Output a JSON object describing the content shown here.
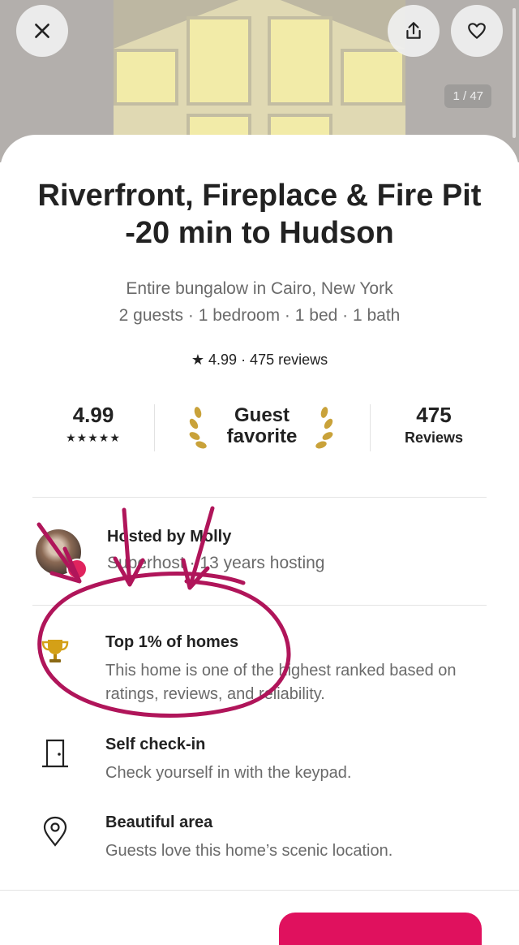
{
  "photo": {
    "counter": "1 / 47"
  },
  "listing": {
    "title": "Riverfront, Fireplace & Fire Pit -20 min to Hudson",
    "subtitle": "Entire bungalow in Cairo, New York",
    "details": "2 guests · 1 bedroom · 1 bed · 1 bath",
    "rating_line": "★ 4.99  ·  475 reviews"
  },
  "stats": {
    "rating": "4.99",
    "stars": "★★★★★",
    "badge": "Guest favorite",
    "reviews_count": "475",
    "reviews_label": "Reviews"
  },
  "host": {
    "name": "Hosted by Molly",
    "meta": "Superhost · 13 years hosting"
  },
  "highlights": [
    {
      "icon": "trophy-icon",
      "title": "Top 1% of homes",
      "desc": "This home is one of the highest ranked based on ratings, reviews, and reliability."
    },
    {
      "icon": "door-icon",
      "title": "Self check-in",
      "desc": "Check yourself in with the keypad."
    },
    {
      "icon": "map-pin-icon",
      "title": "Beautiful area",
      "desc": "Guests love this home’s scenic location."
    }
  ],
  "colors": {
    "accent": "#e0115e",
    "annotation": "#b0155a",
    "muted_text": "#6a6a6a"
  }
}
